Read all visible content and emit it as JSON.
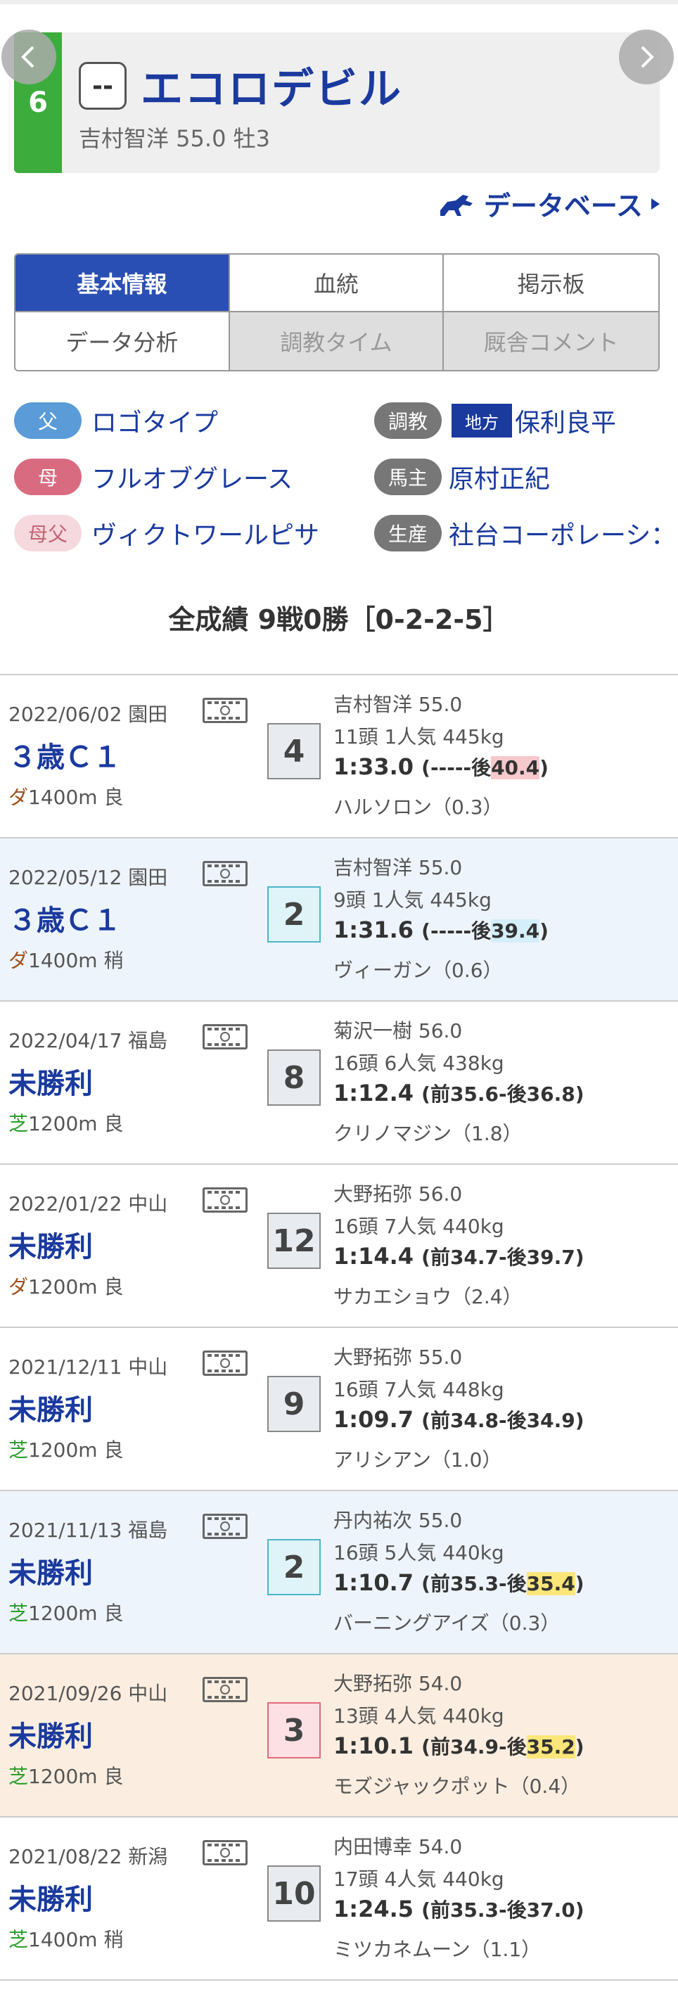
{
  "header": {
    "post_position": "6",
    "mark": "--",
    "horse_name": "エコロデビル",
    "sub": "吉村智洋 55.0 牡3",
    "database_link": "データベース"
  },
  "tabs": [
    {
      "label": "基本情報",
      "state": "active"
    },
    {
      "label": "血統",
      "state": "normal"
    },
    {
      "label": "掲示板",
      "state": "normal"
    },
    {
      "label": "データ分析",
      "state": "normal"
    },
    {
      "label": "調教タイム",
      "state": "disabled"
    },
    {
      "label": "厩舎コメント",
      "state": "disabled"
    }
  ],
  "info": {
    "father_tag": "父",
    "father": "ロゴタイプ",
    "mother_tag": "母",
    "mother": "フルオブグレース",
    "mf_tag": "母父",
    "mother_father": "ヴィクトワールピサ",
    "trainer_tag": "調教",
    "trainer_region": "地方",
    "trainer": "保利良平",
    "owner_tag": "馬主",
    "owner": "原村正紀",
    "breeder_tag": "生産",
    "breeder": "社台コーポレーシ："
  },
  "record": "全成績 9戦0勝［0-2-2-5］",
  "races": [
    {
      "date": "2022/06/02 園田",
      "name": "３歳Ｃ１",
      "surface": "ダ",
      "distance": "1400m 良",
      "rank": "4",
      "jockey": "吉村智洋 55.0",
      "horses": "11頭 1人気 445kg",
      "time": "1:33.0",
      "pace_pre": "(-----後",
      "last": "40.4",
      "pace_post": ")",
      "winner": "ハルソロン（0.3）",
      "rowtone": "white",
      "hl": "red"
    },
    {
      "date": "2022/05/12 園田",
      "name": "３歳Ｃ１",
      "surface": "ダ",
      "distance": "1400m 稍",
      "rank": "2",
      "jockey": "吉村智洋 55.0",
      "horses": "9頭 1人気 445kg",
      "time": "1:31.6",
      "pace_pre": "(-----後",
      "last": "39.4",
      "pace_post": ")",
      "winner": "ヴィーガン（0.6）",
      "rowtone": "blue",
      "hl": "blue"
    },
    {
      "date": "2022/04/17 福島",
      "name": "未勝利",
      "surface": "芝",
      "distance": "1200m 良",
      "rank": "8",
      "jockey": "菊沢一樹 56.0",
      "horses": "16頭 6人気 438kg",
      "time": "1:12.4",
      "pace_pre": "(前35.6-後",
      "last": "36.8",
      "pace_post": ")",
      "winner": "クリノマジン（1.8）",
      "rowtone": "white",
      "hl": "none"
    },
    {
      "date": "2022/01/22 中山",
      "name": "未勝利",
      "surface": "ダ",
      "distance": "1200m 良",
      "rank": "12",
      "jockey": "大野拓弥 56.0",
      "horses": "16頭 7人気 440kg",
      "time": "1:14.4",
      "pace_pre": "(前34.7-後",
      "last": "39.7",
      "pace_post": ")",
      "winner": "サカエショウ（2.4）",
      "rowtone": "white",
      "hl": "none"
    },
    {
      "date": "2021/12/11 中山",
      "name": "未勝利",
      "surface": "芝",
      "distance": "1200m 良",
      "rank": "9",
      "jockey": "大野拓弥 55.0",
      "horses": "16頭 7人気 448kg",
      "time": "1:09.7",
      "pace_pre": "(前34.8-後",
      "last": "34.9",
      "pace_post": ")",
      "winner": "アリシアン（1.0）",
      "rowtone": "white",
      "hl": "none"
    },
    {
      "date": "2021/11/13 福島",
      "name": "未勝利",
      "surface": "芝",
      "distance": "1200m 良",
      "rank": "2",
      "jockey": "丹内祐次 55.0",
      "horses": "16頭 5人気 440kg",
      "time": "1:10.7",
      "pace_pre": "(前35.3-後",
      "last": "35.4",
      "pace_post": ")",
      "winner": "バーニングアイズ（0.3）",
      "rowtone": "blue",
      "hl": "yel"
    },
    {
      "date": "2021/09/26 中山",
      "name": "未勝利",
      "surface": "芝",
      "distance": "1200m 良",
      "rank": "3",
      "jockey": "大野拓弥 54.0",
      "horses": "13頭 4人気 440kg",
      "time": "1:10.1",
      "pace_pre": "(前34.9-後",
      "last": "35.2",
      "pace_post": ")",
      "winner": "モズジャックポット（0.4）",
      "rowtone": "orange",
      "hl": "yel"
    },
    {
      "date": "2021/08/22 新潟",
      "name": "未勝利",
      "surface": "芝",
      "distance": "1400m 稍",
      "rank": "10",
      "jockey": "内田博幸 54.0",
      "horses": "17頭 4人気 440kg",
      "time": "1:24.5",
      "pace_pre": "(前35.3-後",
      "last": "37.0",
      "pace_post": ")",
      "winner": "ミツカネムーン（1.1）",
      "rowtone": "white",
      "hl": "none"
    }
  ]
}
